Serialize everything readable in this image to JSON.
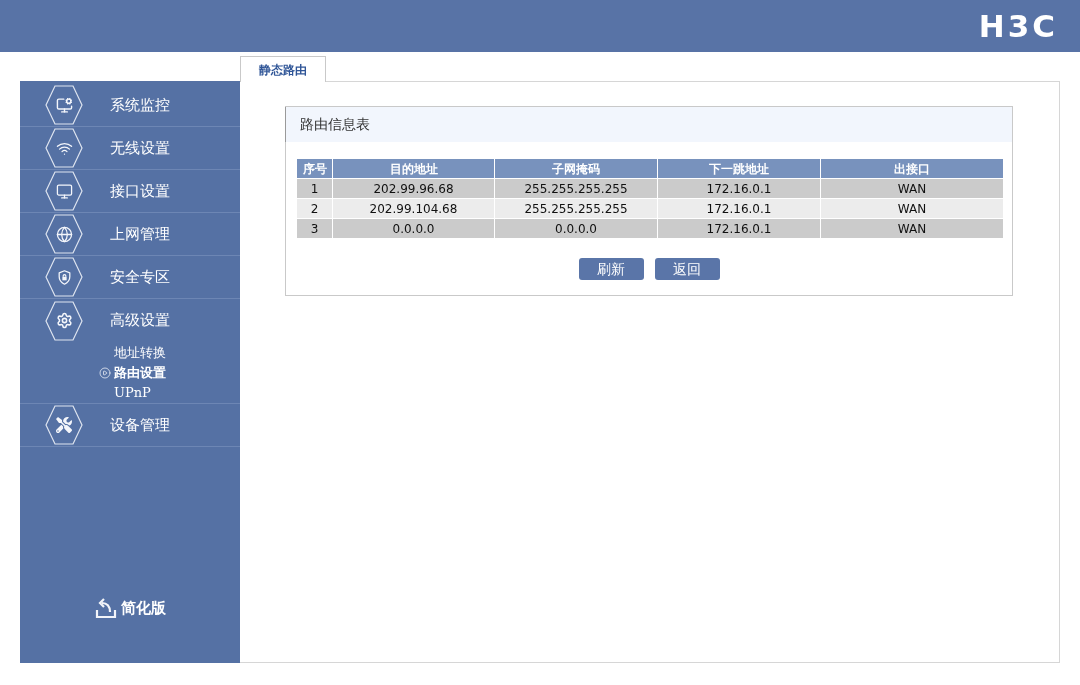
{
  "header": {
    "logo": "H3C"
  },
  "tabs": [
    {
      "label": "静态路由",
      "selected": true
    }
  ],
  "sidebar": {
    "items": [
      {
        "label": "系统监控"
      },
      {
        "label": "无线设置"
      },
      {
        "label": "接口设置"
      },
      {
        "label": "上网管理"
      },
      {
        "label": "安全专区"
      },
      {
        "label": "高级设置",
        "children": [
          {
            "label": "地址转换",
            "selected": false
          },
          {
            "label": "路由设置",
            "selected": true
          },
          {
            "label": "UPnP",
            "selected": false
          }
        ]
      },
      {
        "label": "设备管理"
      }
    ],
    "footer_link": "简化版"
  },
  "route_table": {
    "title": "路由信息表",
    "columns": [
      "序号",
      "目的地址",
      "子网掩码",
      "下一跳地址",
      "出接口"
    ],
    "rows": [
      [
        "1",
        "202.99.96.68",
        "255.255.255.255",
        "172.16.0.1",
        "WAN"
      ],
      [
        "2",
        "202.99.104.68",
        "255.255.255.255",
        "172.16.0.1",
        "WAN"
      ],
      [
        "3",
        "0.0.0.0",
        "0.0.0.0",
        "172.16.0.1",
        "WAN"
      ]
    ],
    "buttons": [
      "刷新",
      "返回"
    ]
  }
}
